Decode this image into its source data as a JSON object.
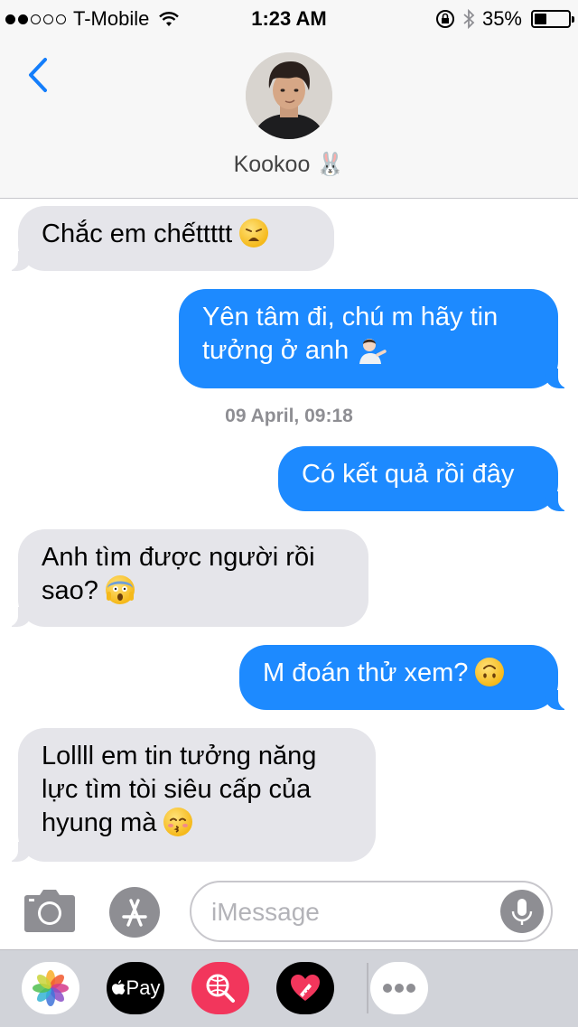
{
  "status_bar": {
    "carrier": "T-Mobile",
    "time": "1:23 AM",
    "battery": "35%",
    "battery_level": 0.35
  },
  "header": {
    "contact_name": "Kookoo 🐰"
  },
  "messages": [
    {
      "side": "in",
      "text": "Chắc em chếttttt",
      "emoji": "weary-face"
    },
    {
      "side": "out",
      "line1": "Yên tâm đi, chú m hãy tin",
      "line2": "tưởng ở anh",
      "emoji": "person-tipping-hand"
    },
    {
      "side": "out",
      "text": "Có kết quả rồi đây"
    },
    {
      "side": "in",
      "line1": "Anh tìm được người rồi",
      "line2": "sao?",
      "emoji": "face-screaming-in-fear"
    },
    {
      "side": "out",
      "text": "M đoán thử xem?",
      "emoji": "upside-down-face"
    },
    {
      "side": "in",
      "line1": "Lollll em tin tưởng năng",
      "line2": "lực tìm tòi siêu cấp của",
      "line3": "hyung mà",
      "emoji": "kissing-face-closed-eyes"
    }
  ],
  "timestamp": "09 April, 09:18",
  "composer": {
    "placeholder": "iMessage"
  },
  "app_drawer": {
    "apple_pay_label": "Pay"
  },
  "colors": {
    "outgoing": "#1d8aff",
    "incoming": "#e5e5ea",
    "accent": "#147efb"
  }
}
